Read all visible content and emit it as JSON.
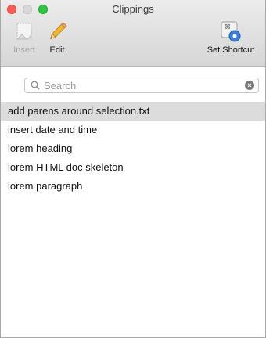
{
  "window": {
    "title": "Clippings"
  },
  "toolbar": {
    "insert_label": "Insert",
    "edit_label": "Edit",
    "set_shortcut_label": "Set Shortcut",
    "icons": {
      "insert": "clipping-insert-icon",
      "edit": "pencil-icon",
      "set_shortcut": "command-gear-icon"
    }
  },
  "search": {
    "placeholder": "Search",
    "value": ""
  },
  "clippings": {
    "items": [
      {
        "label": "add parens around selection.txt",
        "selected": true
      },
      {
        "label": "insert date and time",
        "selected": false
      },
      {
        "label": "lorem heading",
        "selected": false
      },
      {
        "label": "lorem HTML doc skeleton",
        "selected": false
      },
      {
        "label": "lorem paragraph",
        "selected": false
      }
    ]
  },
  "colors": {
    "selection": "#dcdcdc",
    "close": "#fc5d57",
    "zoom": "#2cc840"
  }
}
